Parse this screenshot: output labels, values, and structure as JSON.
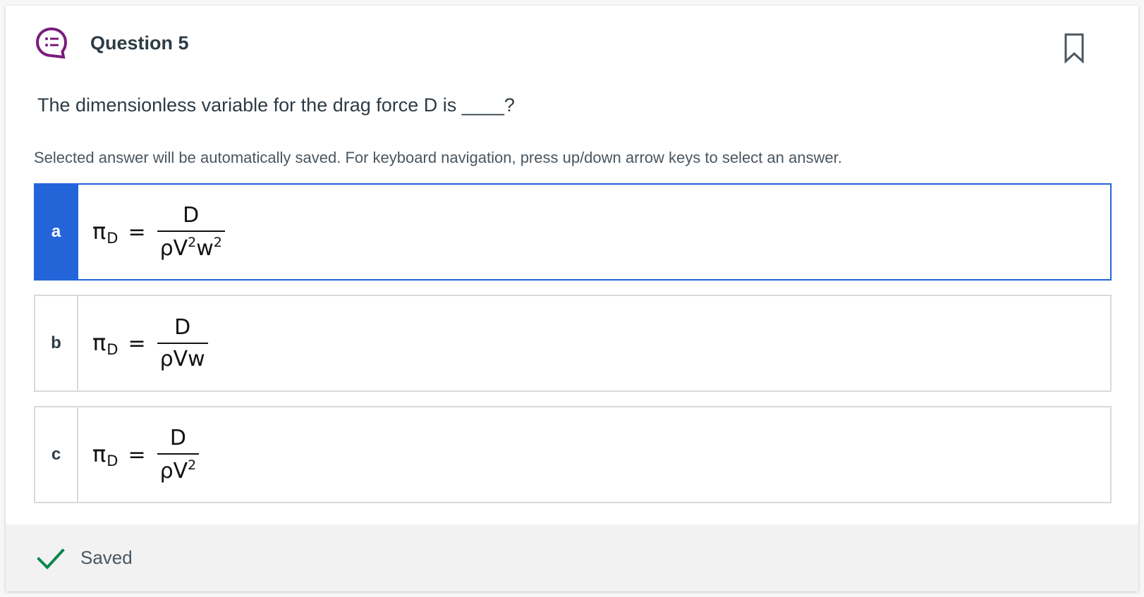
{
  "question": {
    "title": "Question 5",
    "prompt": "The dimensionless variable for the drag force D is ____?",
    "hint": "Selected answer will be automatically saved. For keyboard navigation, press up/down arrow keys to select an answer."
  },
  "choices": [
    {
      "letter": "a",
      "lhs": "π",
      "lhs_sub": "D",
      "eq": "=",
      "numerator": "D",
      "denominator": [
        "ρV",
        "2",
        "w",
        "2"
      ],
      "selected": true
    },
    {
      "letter": "b",
      "lhs": "π",
      "lhs_sub": "D",
      "eq": "=",
      "numerator": "D",
      "denominator": [
        "ρVw"
      ],
      "selected": false
    },
    {
      "letter": "c",
      "lhs": "π",
      "lhs_sub": "D",
      "eq": "=",
      "numerator": "D",
      "denominator": [
        "ρV",
        "2"
      ],
      "selected": false
    }
  ],
  "footer": {
    "status": "Saved"
  },
  "colors": {
    "accent": "#2365d9",
    "icon_purple": "#7b1c7e",
    "saved_green": "#0b874b"
  },
  "icons": {
    "question": "question-list-icon",
    "bookmark": "bookmark-icon",
    "saved": "checkmark-icon"
  }
}
